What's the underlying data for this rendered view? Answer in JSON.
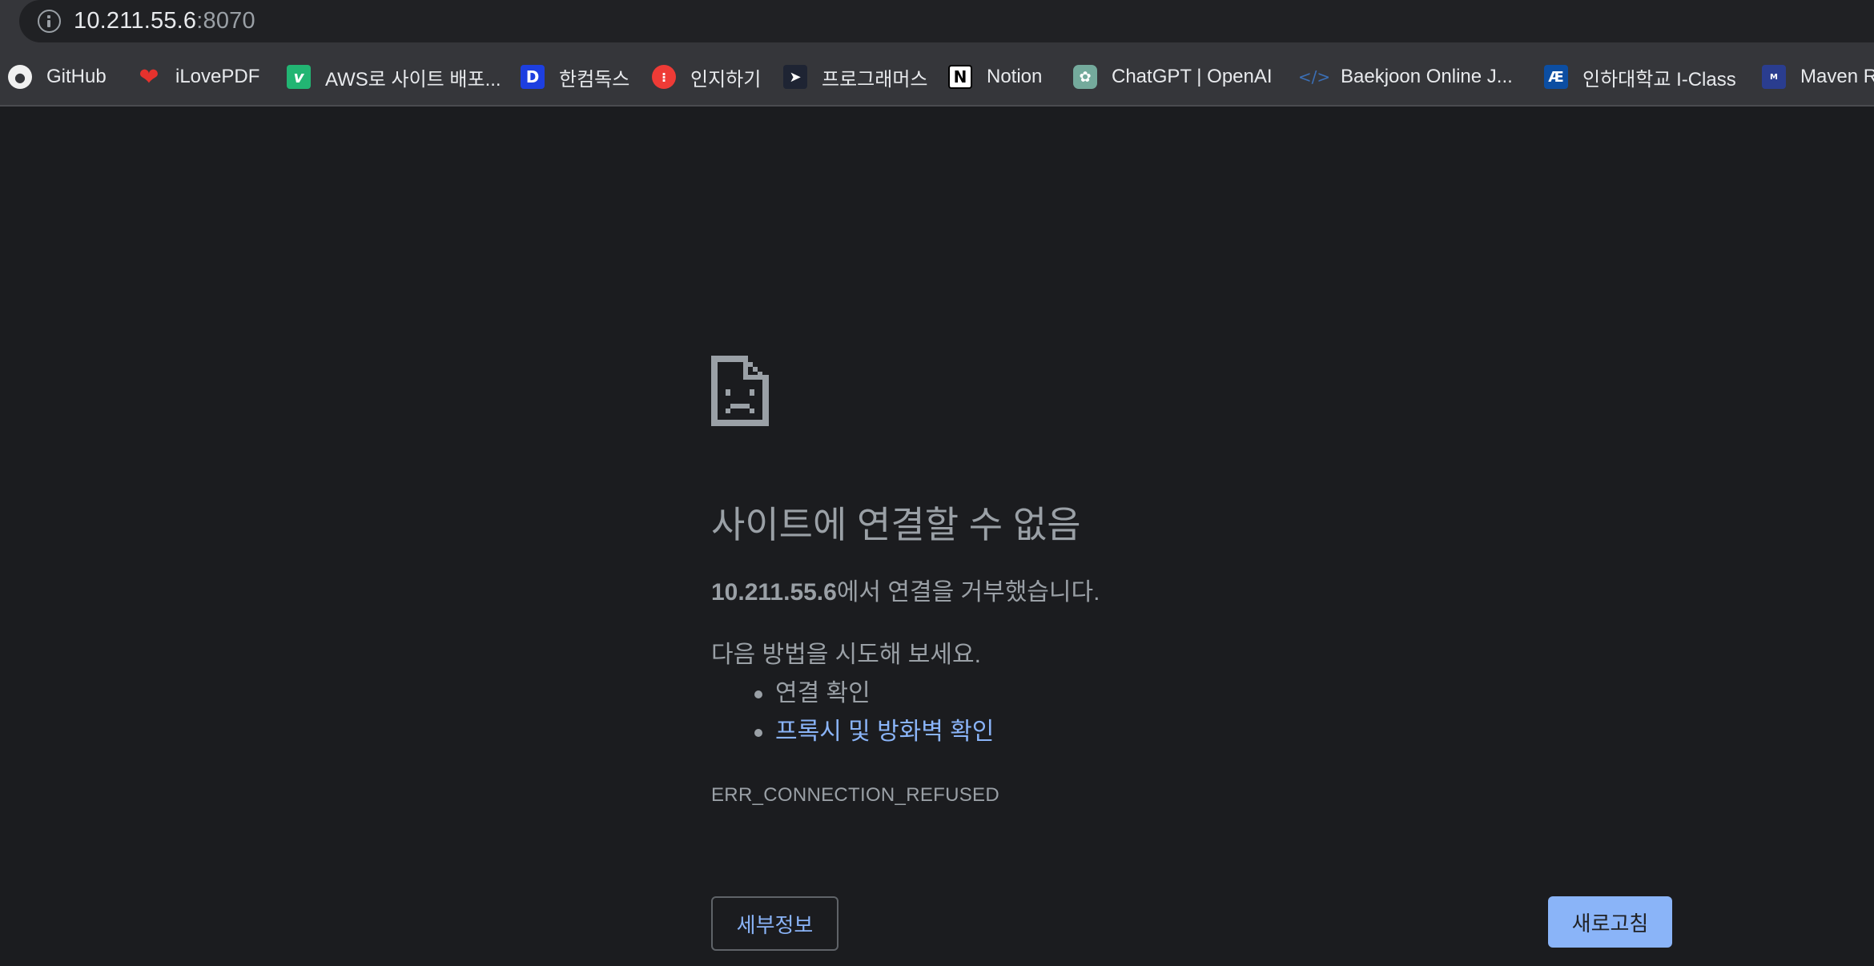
{
  "address_bar": {
    "host": "10.211.55.6",
    "port": ":8070",
    "icon": "info-icon"
  },
  "bookmarks": [
    {
      "label": "GitHub",
      "icon": "github-icon",
      "glyph": "●"
    },
    {
      "label": "iLovePDF",
      "icon": "ilovepdf-heart-icon",
      "glyph": "❤"
    },
    {
      "label": "AWS로 사이트 배포...",
      "icon": "v-logo-icon",
      "glyph": "v"
    },
    {
      "label": "한컴독스",
      "icon": "hancom-docs-icon",
      "glyph": "D"
    },
    {
      "label": "인지하기",
      "icon": "inji-icon",
      "glyph": "⁝"
    },
    {
      "label": "프로그래머스",
      "icon": "programmers-icon",
      "glyph": "➤"
    },
    {
      "label": "Notion",
      "icon": "notion-icon",
      "glyph": "N"
    },
    {
      "label": "ChatGPT | OpenAI",
      "icon": "openai-icon",
      "glyph": "✿"
    },
    {
      "label": "Baekjoon Online J...",
      "icon": "baekjoon-icon",
      "glyph": "</>"
    },
    {
      "label": "인하대학교 I-Class",
      "icon": "inha-iclass-icon",
      "glyph": "Æ"
    },
    {
      "label": "Maven R",
      "icon": "maven-icon",
      "glyph": "M"
    }
  ],
  "error": {
    "icon": "sad-file-icon",
    "title": "사이트에 연결할 수 없음",
    "host_bold": "10.211.55.6",
    "refused_text": "에서 연결을 거부했습니다.",
    "try_text": "다음 방법을 시도해 보세요.",
    "suggestions": [
      "연결 확인",
      "프록시 및 방화벽 확인"
    ],
    "code": "ERR_CONNECTION_REFUSED",
    "details_button": "세부정보",
    "reload_button": "새로고침"
  },
  "colors": {
    "background": "#1b1c1f",
    "link": "#8ab4f8",
    "secondary_text": "#9aa0a6",
    "toolbar": "#35363a"
  }
}
